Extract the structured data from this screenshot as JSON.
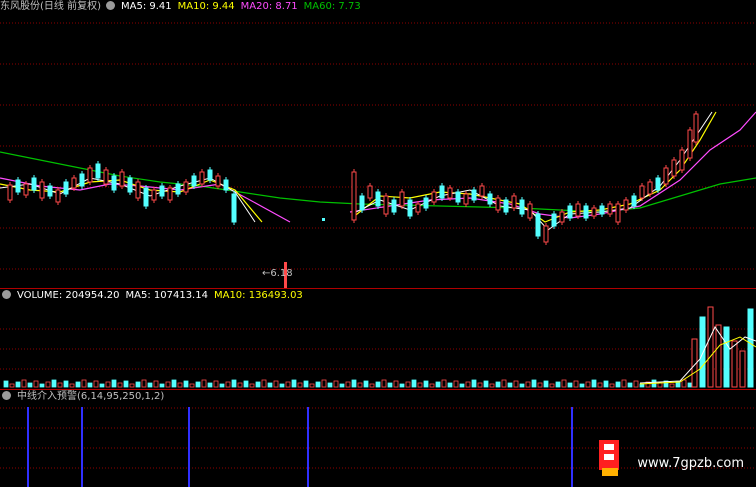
{
  "main": {
    "title": "东风股份(日线 前复权)",
    "ma5_label": "MA5: 9.41",
    "ma10_label": "MA10: 9.44",
    "ma20_label": "MA20: 8.71",
    "ma60_label": "MA60: 7.73",
    "low_label": "6.18"
  },
  "volume": {
    "vol_label": "VOLUME: 204954.20",
    "ma5_label": "MA5: 107413.14",
    "ma10_label": "MA10: 136493.03"
  },
  "indicator": {
    "title": "中线介入预警(6,14,95,250,1,2)"
  },
  "watermark": "www.7gpzb.com",
  "colors": {
    "up": "#ff4a4a",
    "down": "#54ffff",
    "ma5": "#ffffff",
    "ma10": "#ffff00",
    "ma20": "#ff4cff",
    "ma60": "#00c000",
    "signal": "#3030ff",
    "grid": "#8b0000"
  }
}
